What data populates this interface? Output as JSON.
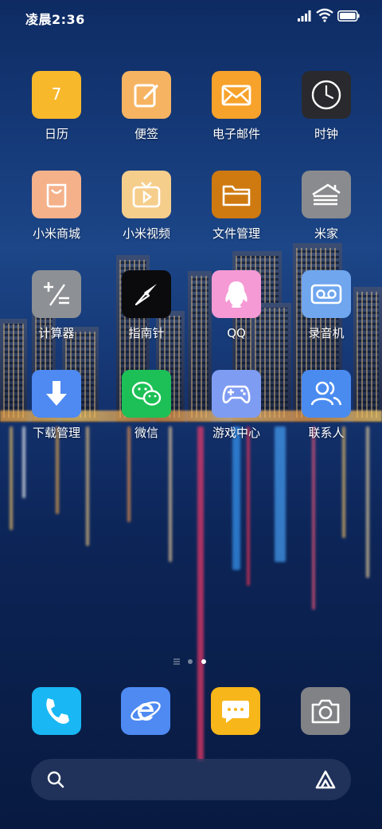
{
  "status_bar": {
    "time": "凌晨2:36",
    "icons": [
      "signal-icon",
      "wifi-icon",
      "battery-icon"
    ]
  },
  "apps": [
    {
      "name": "app-calendar",
      "label": "日历",
      "icon": "calendar-icon",
      "color": "#F8B82B",
      "text": "7"
    },
    {
      "name": "app-notes",
      "label": "便签",
      "icon": "notes-icon",
      "color": "#F6B462"
    },
    {
      "name": "app-email",
      "label": "电子邮件",
      "icon": "mail-icon",
      "color": "#F7A22A"
    },
    {
      "name": "app-clock",
      "label": "时钟",
      "icon": "clock-icon",
      "color": "#2A2A2E"
    },
    {
      "name": "app-mi-store",
      "label": "小米商城",
      "icon": "shopping-bag-icon",
      "color": "#F4B18A"
    },
    {
      "name": "app-mi-video",
      "label": "小米视频",
      "icon": "tv-play-icon",
      "color": "#F6CE8C"
    },
    {
      "name": "app-file-manager",
      "label": "文件管理",
      "icon": "folder-icon",
      "color": "#CF7A11"
    },
    {
      "name": "app-mi-home",
      "label": "米家",
      "icon": "mi-home-icon",
      "color": "#8A8B8E"
    },
    {
      "name": "app-calculator",
      "label": "计算器",
      "icon": "calculator-icon",
      "color": "#8D9094"
    },
    {
      "name": "app-compass",
      "label": "指南针",
      "icon": "compass-icon",
      "color": "#0B0B0D"
    },
    {
      "name": "app-qq",
      "label": "QQ",
      "icon": "penguin-icon",
      "color": "#F59AD5"
    },
    {
      "name": "app-recorder",
      "label": "录音机",
      "icon": "voicemail-icon",
      "color": "#6FA6EE"
    },
    {
      "name": "app-downloads",
      "label": "下载管理",
      "icon": "download-arrow-icon",
      "color": "#4E8AF2"
    },
    {
      "name": "app-wechat",
      "label": "微信",
      "icon": "wechat-icon",
      "color": "#1DC056"
    },
    {
      "name": "app-game-center",
      "label": "游戏中心",
      "icon": "gamepad-icon",
      "color": "#7F9CF3"
    },
    {
      "name": "app-contacts",
      "label": "联系人",
      "icon": "contacts-icon",
      "color": "#4A8BF0"
    }
  ],
  "page_indicator": {
    "pages": 3,
    "current": 3
  },
  "dock": [
    {
      "name": "dock-phone",
      "icon": "phone-icon",
      "color": "#19B7F4"
    },
    {
      "name": "dock-browser",
      "icon": "browser-e-icon",
      "color": "#4E8AF2"
    },
    {
      "name": "dock-messages",
      "icon": "chat-bubble-icon",
      "color": "#F7B619"
    },
    {
      "name": "dock-camera",
      "icon": "camera-icon",
      "color": "#818286"
    }
  ],
  "search_bar": {
    "left_icon": "search-icon",
    "right_icon": "xiaoai-assistant-icon"
  }
}
